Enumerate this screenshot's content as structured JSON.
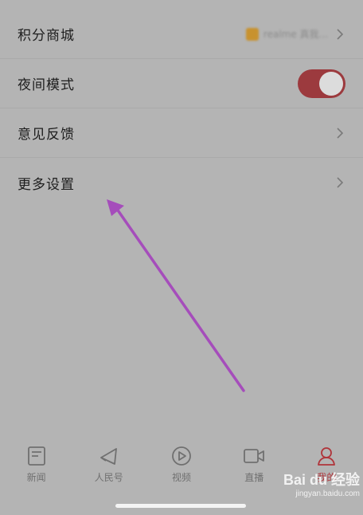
{
  "settings": {
    "items": [
      {
        "label": "积分商城",
        "preview": "realme 真我..."
      },
      {
        "label": "夜间模式",
        "toggle_on": true
      },
      {
        "label": "意见反馈"
      },
      {
        "label": "更多设置"
      }
    ]
  },
  "tabbar": {
    "items": [
      {
        "label": "新闻",
        "icon": "news-icon"
      },
      {
        "label": "人民号",
        "icon": "megaphone-icon"
      },
      {
        "label": "视频",
        "icon": "play-icon"
      },
      {
        "label": "直播",
        "icon": "video-camera-icon"
      },
      {
        "label": "我的",
        "icon": "person-icon",
        "active": true
      }
    ]
  },
  "watermark": {
    "logo": "Bai du 经验",
    "url": "jingyan.baidu.com"
  },
  "colors": {
    "background": "#b4b4b4",
    "accent": "#b0343a",
    "toggle": "#9c3a3e",
    "annotation_arrow": "#a54dbb"
  }
}
